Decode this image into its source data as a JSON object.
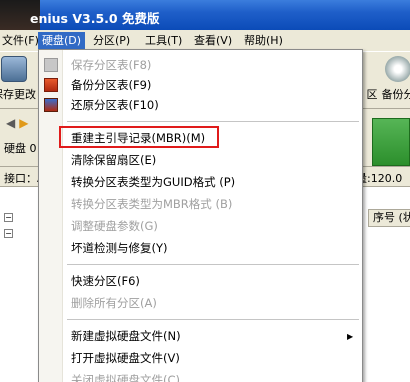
{
  "window": {
    "title": "enius V3.5.0 免费版"
  },
  "menubar": {
    "items": [
      {
        "label": "文件(F)"
      },
      {
        "label": "硬盘(D)"
      },
      {
        "label": "分区(P)"
      },
      {
        "label": "工具(T)"
      },
      {
        "label": "查看(V)"
      },
      {
        "label": "帮助(H)"
      }
    ]
  },
  "toolbar": {
    "save_label": "保存更改",
    "partition_label": "区",
    "backup_label": "备份分"
  },
  "disk": {
    "label": "硬盘 0",
    "interface_label": "接口：A",
    "capacity_label": "量:120.0"
  },
  "table": {
    "col_seq": "序号 (状"
  },
  "dropdown": {
    "items": [
      {
        "text": "保存分区表(F8)",
        "disabled": true
      },
      {
        "text": "备份分区表(F9)",
        "disabled": false
      },
      {
        "text": "还原分区表(F10)",
        "disabled": false
      },
      {
        "text": "重建主引导记录(MBR)(M)",
        "disabled": false
      },
      {
        "text": "清除保留扇区(E)",
        "disabled": false
      },
      {
        "text": "转换分区表类型为GUID格式 (P)",
        "disabled": false
      },
      {
        "text": "转换分区表类型为MBR格式 (B)",
        "disabled": true
      },
      {
        "text": "调整硬盘参数(G)",
        "disabled": true
      },
      {
        "text": "坏道检测与修复(Y)",
        "disabled": false
      },
      {
        "text": "快速分区(F6)",
        "disabled": false
      },
      {
        "text": "删除所有分区(A)",
        "disabled": true
      },
      {
        "text": "新建虚拟硬盘文件(N)",
        "disabled": false
      },
      {
        "text": "打开虚拟硬盘文件(V)",
        "disabled": false
      },
      {
        "text": "关闭虚拟硬盘文件(C)",
        "disabled": true
      }
    ]
  },
  "colors": {
    "highlight_border": "#e01b1b",
    "menu_active": "#316ac5"
  }
}
